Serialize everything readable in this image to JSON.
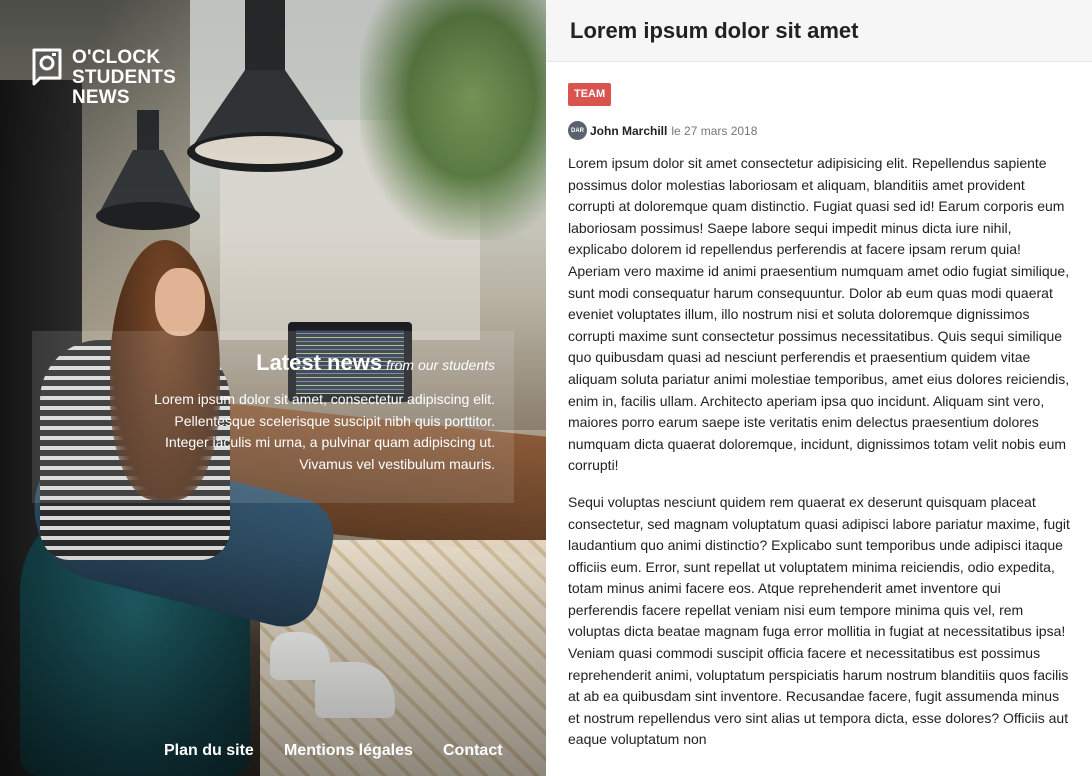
{
  "site": {
    "logo_lines": [
      "O'CLOCK",
      "STUDENTS",
      "NEWS"
    ],
    "icons": {
      "logo": "camera-icon",
      "avatar": "user-avatar"
    }
  },
  "hero": {
    "title": "Latest news",
    "subtitle": "from our students",
    "lines": [
      "Lorem ipsum dolor sit amet, consectetur adipiscing elit.",
      "Pellentesque scelerisque suscipit nibh quis porttitor.",
      "Integer iaculis mi urna, a pulvinar quam adipiscing ut.",
      "Vivamus vel vestibulum mauris."
    ]
  },
  "footer": {
    "links": [
      "Plan du site",
      "Mentions légales",
      "Contact"
    ]
  },
  "article": {
    "title": "Lorem ipsum dolor sit amet",
    "badge": "TEAM",
    "badge_color": "#d9534f",
    "avatar_initials": "DAR",
    "author": "John Marchill",
    "date_prefix": "le",
    "date": "27 mars 2018",
    "paragraphs": [
      "Lorem ipsum dolor sit amet consectetur adipisicing elit. Repellendus sapiente possimus dolor molestias laboriosam et aliquam, blanditiis amet provident corrupti at doloremque quam distinctio. Fugiat quasi sed id! Earum corporis eum laboriosam possimus! Saepe labore sequi impedit minus dicta iure nihil, explicabo dolorem id repellendus perferendis at facere ipsam rerum quia! Aperiam vero maxime id animi praesentium numquam amet odio fugiat similique, sunt modi consequatur harum consequuntur. Dolor ab eum quas modi quaerat eveniet voluptates illum, illo nostrum nisi et soluta doloremque dignissimos corrupti maxime sunt consectetur possimus necessitatibus. Quis sequi similique quo quibusdam quasi ad nesciunt perferendis et praesentium quidem vitae aliquam soluta pariatur animi molestiae temporibus, amet eius dolores reiciendis, enim in, facilis ullam. Architecto aperiam ipsa quo incidunt. Aliquam sint vero, maiores porro earum saepe iste veritatis enim delectus praesentium dolores numquam dicta quaerat doloremque, incidunt, dignissimos totam velit nobis eum corrupti!",
      "Sequi voluptas nesciunt quidem rem quaerat ex deserunt quisquam placeat consectetur, sed magnam voluptatum quasi adipisci labore pariatur maxime, fugit laudantium quo animi distinctio? Explicabo sunt temporibus unde adipisci itaque officiis eum. Error, sunt repellat ut voluptatem minima reiciendis, odio expedita, totam minus animi facere eos. Atque reprehenderit amet inventore qui perferendis facere repellat veniam nisi eum tempore minima quis vel, rem voluptas dicta beatae magnam fuga error mollitia in fugiat at necessitatibus ipsa! Veniam quasi commodi suscipit officia facere et necessitatibus est possimus reprehenderit animi, voluptatum perspiciatis harum nostrum blanditiis quos facilis at ab ea quibusdam sint inventore. Recusandae facere, fugit assumenda minus et nostrum repellendus vero sint alias ut tempora dicta, esse dolores? Officiis aut eaque voluptatum non"
    ]
  }
}
